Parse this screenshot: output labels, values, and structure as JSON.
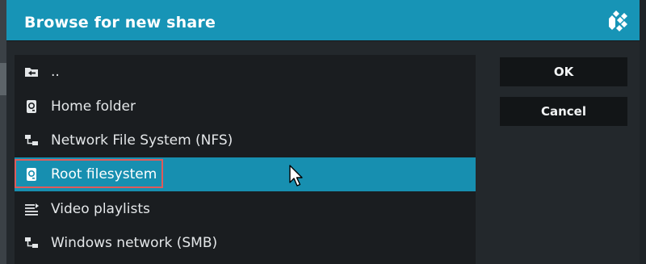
{
  "dialog": {
    "title": "Browse for new share"
  },
  "list": {
    "items": [
      {
        "label": "..",
        "icon": "back-folder-icon",
        "selected": false
      },
      {
        "label": "Home folder",
        "icon": "drive-icon",
        "selected": false
      },
      {
        "label": "Network File System (NFS)",
        "icon": "network-icon",
        "selected": false
      },
      {
        "label": "Root filesystem",
        "icon": "drive-icon",
        "selected": true
      },
      {
        "label": "Video playlists",
        "icon": "playlist-icon",
        "selected": false
      },
      {
        "label": "Windows network (SMB)",
        "icon": "network-icon",
        "selected": false
      }
    ]
  },
  "buttons": {
    "ok": "OK",
    "cancel": "Cancel"
  },
  "colors": {
    "accent": "#1794b6",
    "selected_row": "#178fb0",
    "highlight_outline": "#e05a5a"
  }
}
